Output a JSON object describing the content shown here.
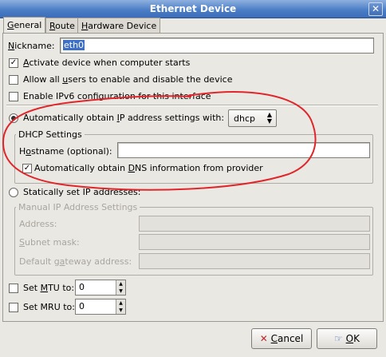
{
  "window": {
    "title": "Ethernet Device",
    "close_icon": "✕"
  },
  "tabs": [
    {
      "label": "General",
      "active": true
    },
    {
      "label": "Route",
      "active": false
    },
    {
      "label": "Hardware Device",
      "active": false
    }
  ],
  "general": {
    "nickname_label": "Nickname:",
    "nickname_value": "eth0",
    "activate_label": "Activate device when computer starts",
    "activate_checked": true,
    "allow_users_label": "Allow all users to enable and disable the device",
    "allow_users_checked": false,
    "ipv6_label": "Enable IPv6 configuration for this interface",
    "ipv6_checked": false,
    "auto_ip_label": "Automatically obtain IP address settings with:",
    "auto_ip_selected": true,
    "auto_ip_method": "dhcp",
    "dhcp_settings_title": "DHCP Settings",
    "hostname_label": "Hostname (optional):",
    "hostname_value": "",
    "auto_dns_label": "Automatically obtain DNS information from provider",
    "auto_dns_checked": true,
    "static_label": "Statically set IP addresses:",
    "static_selected": false,
    "manual_title": "Manual IP Address Settings",
    "address_label": "Address:",
    "subnet_label": "Subnet mask:",
    "gateway_label": "Default gateway address:",
    "mtu_label": "Set MTU to:",
    "mtu_value": "0",
    "mtu_checked": false,
    "mru_label": "Set MRU to:",
    "mru_value": "0",
    "mru_checked": false
  },
  "buttons": {
    "cancel_label": "Cancel",
    "ok_label": "OK"
  },
  "colors": {
    "titlebar": "#4d7fc7",
    "annotation": "#e0262a",
    "selection": "#3d6fc6"
  }
}
